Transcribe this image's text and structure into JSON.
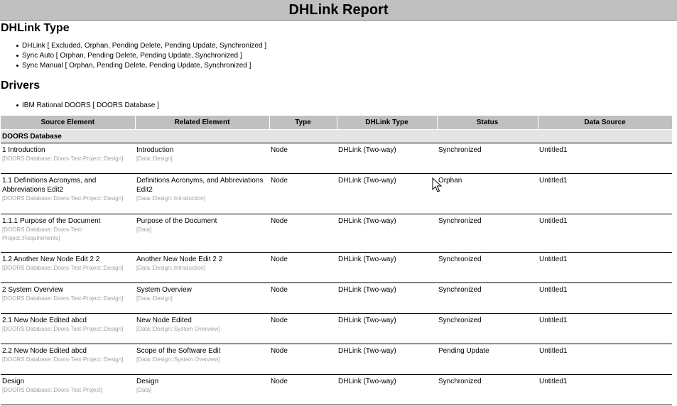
{
  "report": {
    "title": "DHLink Report"
  },
  "dhlink_type": {
    "heading": "DHLink Type",
    "items": [
      "DHLink [ Excluded, Orphan, Pending Delete, Pending Update, Synchronized ]",
      "Sync Auto [ Orphan, Pending Delete, Pending Update, Synchronized ]",
      "Sync Manual [ Orphan, Pending Delete, Pending Update, Synchronized ]"
    ]
  },
  "drivers": {
    "heading": "Drivers",
    "items": [
      "IBM Rational DOORS [ DOORS Database ]"
    ]
  },
  "table": {
    "columns": [
      "Source Element",
      "Related Element",
      "Type",
      "DHLink Type",
      "Status",
      "Data Source"
    ],
    "group": "DOORS Database",
    "rows": [
      {
        "source": "1 Introduction",
        "source_path": "[DOORS Database::Doors-Test-Project::Design]",
        "related": "Introduction",
        "related_path": "[Data::Design]",
        "type": "Node",
        "dhlink_type": "DHLink (Two-way)",
        "status": "Synchronized",
        "data_source": "Untitled1"
      },
      {
        "source": "1.1 Definitions Acronyms, and Abbreviations Edit2",
        "source_path": "[DOORS Database::Doors-Test-Project::Design]",
        "related": "Definitions Acronyms, and Abbreviations Edit2",
        "related_path": "[Data::Design::Introduction]",
        "type": "Node",
        "dhlink_type": "DHLink (Two-way)",
        "status": "Orphan",
        "data_source": "Untitled1"
      },
      {
        "source": "1.1.1 Purpose of the Document",
        "source_path": "[DOORS Database::Doors-Test-Project::Requirements]",
        "related": "Purpose of the Document",
        "related_path": "[Data]",
        "type": "Node",
        "dhlink_type": "DHLink (Two-way)",
        "status": "Synchronized",
        "data_source": "Untitled1"
      },
      {
        "source": "1.2 Another New Node Edit 2 2",
        "source_path": "[DOORS Database::Doors-Test-Project::Design]",
        "related": "Another New Node Edit 2 2",
        "related_path": "[Data::Design::Introduction]",
        "type": "Node",
        "dhlink_type": "DHLink (Two-way)",
        "status": "Synchronized",
        "data_source": "Untitled1"
      },
      {
        "source": "2 System Overview",
        "source_path": "[DOORS Database::Doors-Test-Project::Design]",
        "related": "System Overview",
        "related_path": "[Data::Design]",
        "type": "Node",
        "dhlink_type": "DHLink (Two-way)",
        "status": "Synchronized",
        "data_source": "Untitled1"
      },
      {
        "source": "2.1 New Node Edited abcd",
        "source_path": "[DOORS Database::Doors-Test-Project::Design]",
        "related": "New Node Edited",
        "related_path": "[Data::Design::System Overview]",
        "type": "Node",
        "dhlink_type": "DHLink (Two-way)",
        "status": "Synchronized",
        "data_source": "Untitled1"
      },
      {
        "source": "2.2 New Node Edited abcd",
        "source_path": "[DOORS Database::Doors-Test-Project::Design]",
        "related": "Scope of the Software Edit",
        "related_path": "[Data::Design::System Overview]",
        "type": "Node",
        "dhlink_type": "DHLink (Two-way)",
        "status": "Pending Update",
        "data_source": "Untitled1"
      },
      {
        "source": "Design",
        "source_path": "[DOORS Database::Doors-Test-Project]",
        "related": "Design",
        "related_path": "[Data]",
        "type": "Node",
        "dhlink_type": "DHLink (Two-way)",
        "status": "Synchronized",
        "data_source": "Untitled1"
      }
    ]
  }
}
